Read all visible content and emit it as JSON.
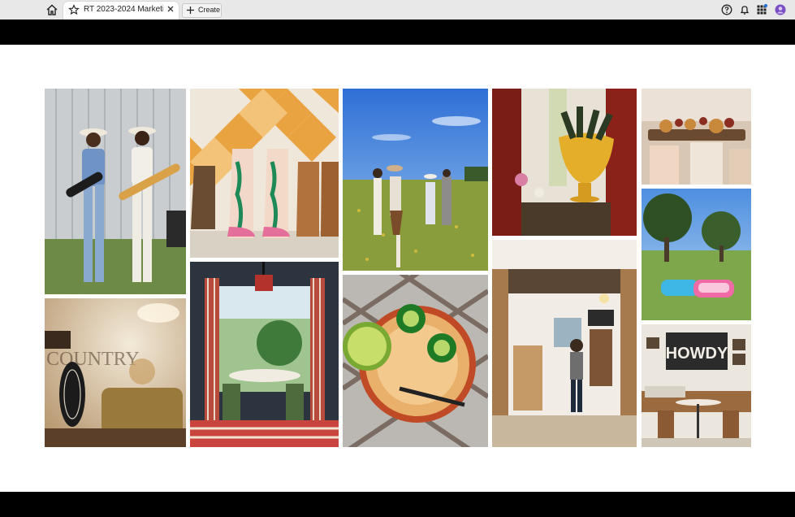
{
  "browser": {
    "tab_title": "RT 2023-2024 Marketi...",
    "create_label": "Create",
    "icons": [
      "home-icon",
      "star-icon",
      "close-icon",
      "plus-icon",
      "help-icon",
      "bell-icon",
      "apps-icon",
      "avatar"
    ]
  },
  "moodboard": {
    "photos": [
      {
        "name": "photo-musicians"
      },
      {
        "name": "photo-cowboy-boots"
      },
      {
        "name": "photo-field-walk"
      },
      {
        "name": "photo-champagne-bowl"
      },
      {
        "name": "photo-charcuterie"
      },
      {
        "name": "photo-pools-lawn"
      },
      {
        "name": "photo-keychain"
      },
      {
        "name": "photo-porch-dining"
      },
      {
        "name": "photo-jalapeno-margarita"
      },
      {
        "name": "photo-barn-entry"
      },
      {
        "name": "photo-howdy-room"
      }
    ]
  },
  "colors": {
    "chrome": "#e8e8e8",
    "avatar": "#7a4fc4"
  }
}
